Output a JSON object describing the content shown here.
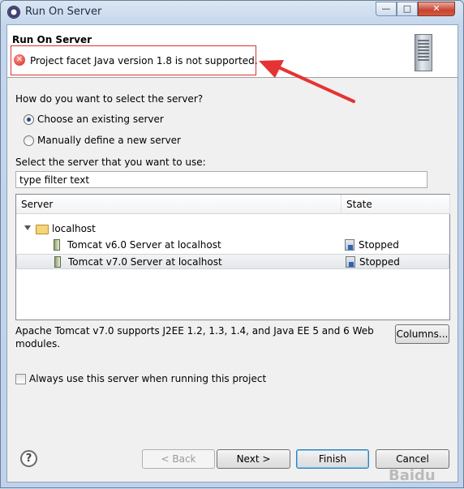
{
  "window": {
    "title": "Run On Server",
    "minimize": "—",
    "maximize": "□",
    "close": "✕"
  },
  "header": {
    "title": "Run On Server",
    "error_message": "Project facet Java version 1.8 is not supported.",
    "icon": "server-icon"
  },
  "selection": {
    "question": "How do you want to select the server?",
    "options": [
      {
        "label": "Choose an existing server",
        "selected": true
      },
      {
        "label": "Manually define a new server",
        "selected": false
      }
    ]
  },
  "filter": {
    "label": "Select the server that you want to use:",
    "value": "type filter text"
  },
  "table": {
    "columns": [
      "Server",
      "State"
    ],
    "group": "localhost",
    "rows": [
      {
        "server": "Tomcat v6.0 Server at localhost",
        "state": "Stopped",
        "selected": false
      },
      {
        "server": "Tomcat v7.0 Server at localhost",
        "state": "Stopped",
        "selected": true
      }
    ]
  },
  "description": "Apache Tomcat v7.0 supports J2EE 1.2, 1.3, 1.4, and Java EE 5 and 6 Web modules.",
  "columns_button": "Columns...",
  "always_use": {
    "label": "Always use this server when running this project",
    "checked": false
  },
  "buttons": {
    "back": "< Back",
    "next": "Next >",
    "finish": "Finish",
    "cancel": "Cancel"
  },
  "help": "?",
  "watermark": "Baidu",
  "colors": {
    "error_border": "#e03030",
    "arrow": "#e53333"
  }
}
